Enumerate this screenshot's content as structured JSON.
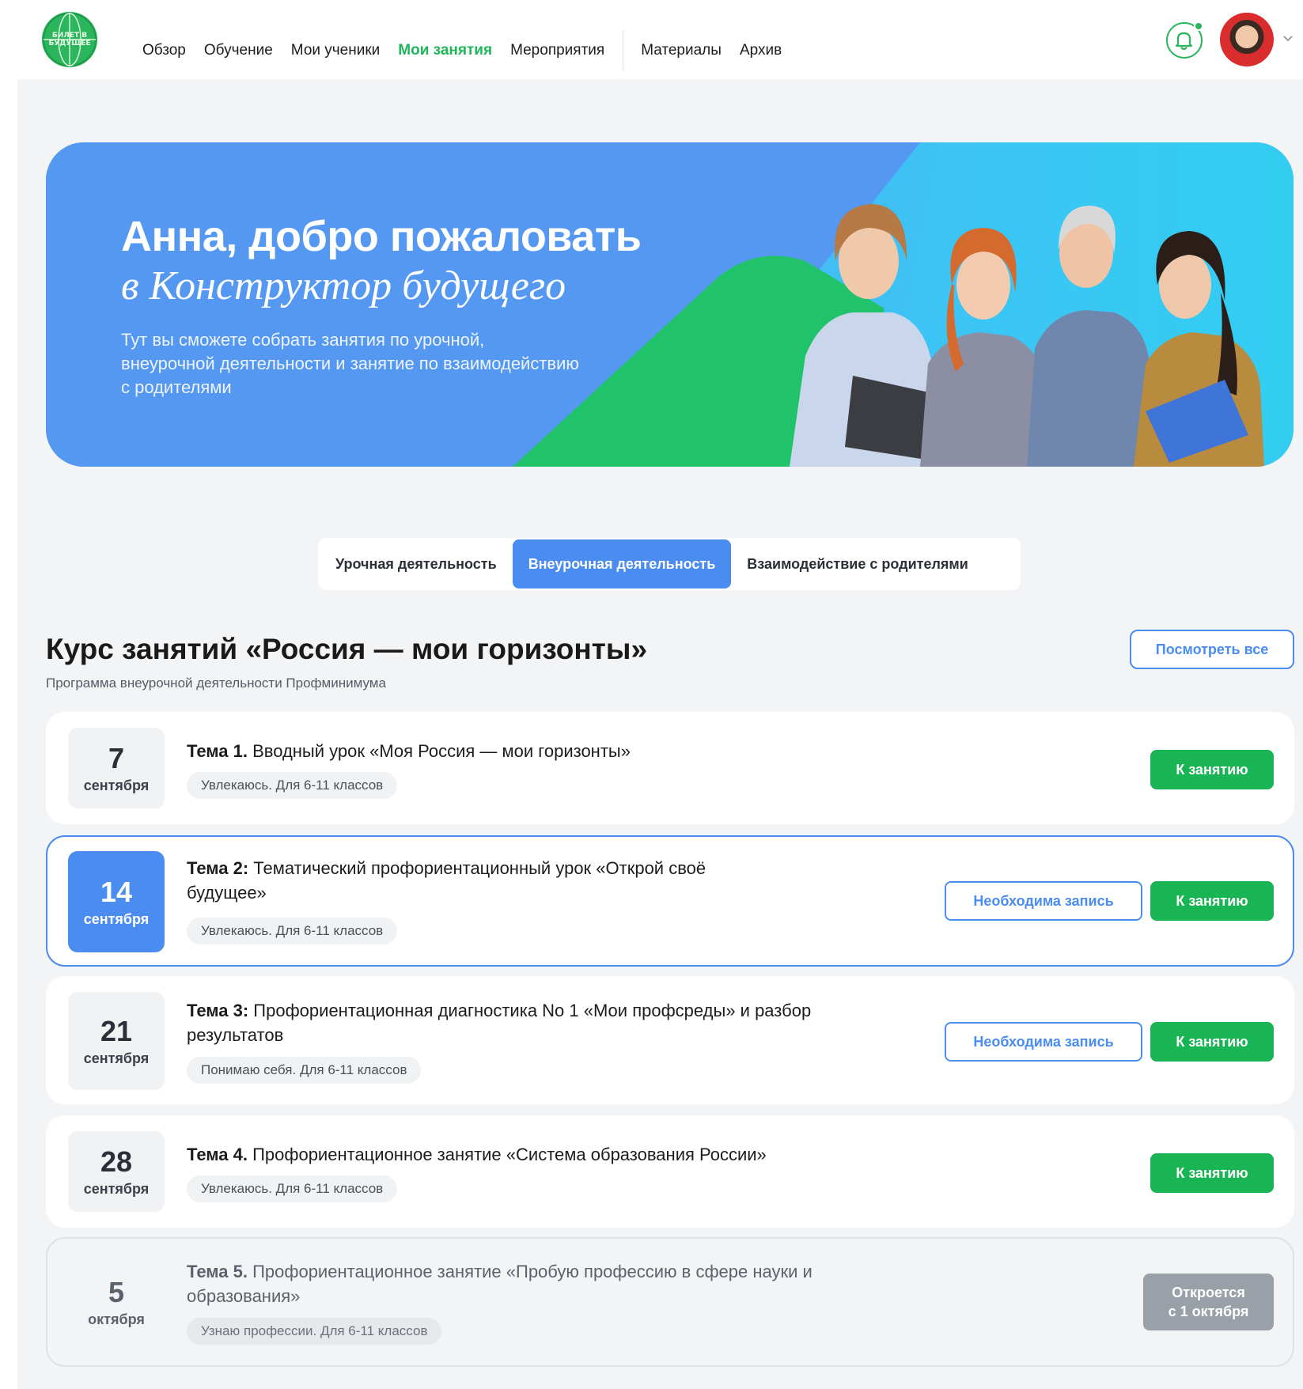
{
  "header": {
    "logo_text": "БИЛЕТ В БУДУЩЕЕ",
    "nav": [
      {
        "label": "Обзор",
        "active": false
      },
      {
        "label": "Обучение",
        "active": false
      },
      {
        "label": "Мои ученики",
        "active": false
      },
      {
        "label": "Мои занятия",
        "active": true
      },
      {
        "label": "Мероприятия",
        "active": false
      },
      {
        "label": "Материалы",
        "active": false
      },
      {
        "label": "Архив",
        "active": false
      }
    ],
    "notification_icon": "bell-icon",
    "user_menu_icon": "chevron-down-icon"
  },
  "hero": {
    "title": "Анна, добро пожаловать",
    "subtitle": "в Конструктор будущего",
    "text": "Тут вы сможете собрать занятия по урочной, внеурочной деятельности и занятие по взаимодействию с родителями"
  },
  "tabs": [
    {
      "label": "Урочная деятельность",
      "active": false
    },
    {
      "label": "Внеурочная деятельность",
      "active": true
    },
    {
      "label": "Взаимодействие с родителями",
      "active": false
    }
  ],
  "course": {
    "title": "Курс занятий «Россия — мои горизонты»",
    "subtitle": "Программа внеурочной деятельности Профминимума",
    "see_all": "Посмотреть все"
  },
  "lessons": [
    {
      "day": "7",
      "month": "сентября",
      "topic": "Тема 1.",
      "title": " Вводный урок «Моя Россия — мои горизонты»",
      "tag": "Увлекаюсь. Для 6-11 классов",
      "need_signup": "",
      "go": "К занятию"
    },
    {
      "day": "14",
      "month": "сентября",
      "topic": "Тема 2:",
      "title": " Тематический профориентационный урок «Открой своё будущее»",
      "tag": "Увлекаюсь. Для 6-11 классов",
      "need_signup": "Необходима запись",
      "go": "К занятию"
    },
    {
      "day": "21",
      "month": "сентября",
      "topic": "Тема 3:",
      "title": " Профориентационная диагностика No 1 «Мои профсреды» и разбор результатов",
      "tag": "Понимаю себя. Для 6-11 классов",
      "need_signup": "Необходима запись",
      "go": "К занятию"
    },
    {
      "day": "28",
      "month": "сентября",
      "topic": "Тема 4.",
      "title": " Профориентационное занятие «Система образования России»",
      "tag": "Увлекаюсь. Для 6-11 классов",
      "need_signup": "",
      "go": "К занятию"
    },
    {
      "day": "5",
      "month": "октября",
      "topic": "Тема 5.",
      "title": " Профориентационное занятие «Пробую профессию в сфере науки и образования»",
      "tag": "Узнаю профессии. Для 6-11 классов",
      "locked": "Откроется\nс 1 октября"
    }
  ],
  "colors": {
    "accent_green": "#19b454",
    "accent_blue": "#4a8cf0",
    "hero_blue": "#5598f2",
    "hero_cyan": "#38c8f4",
    "background": "#f3f4f6"
  }
}
